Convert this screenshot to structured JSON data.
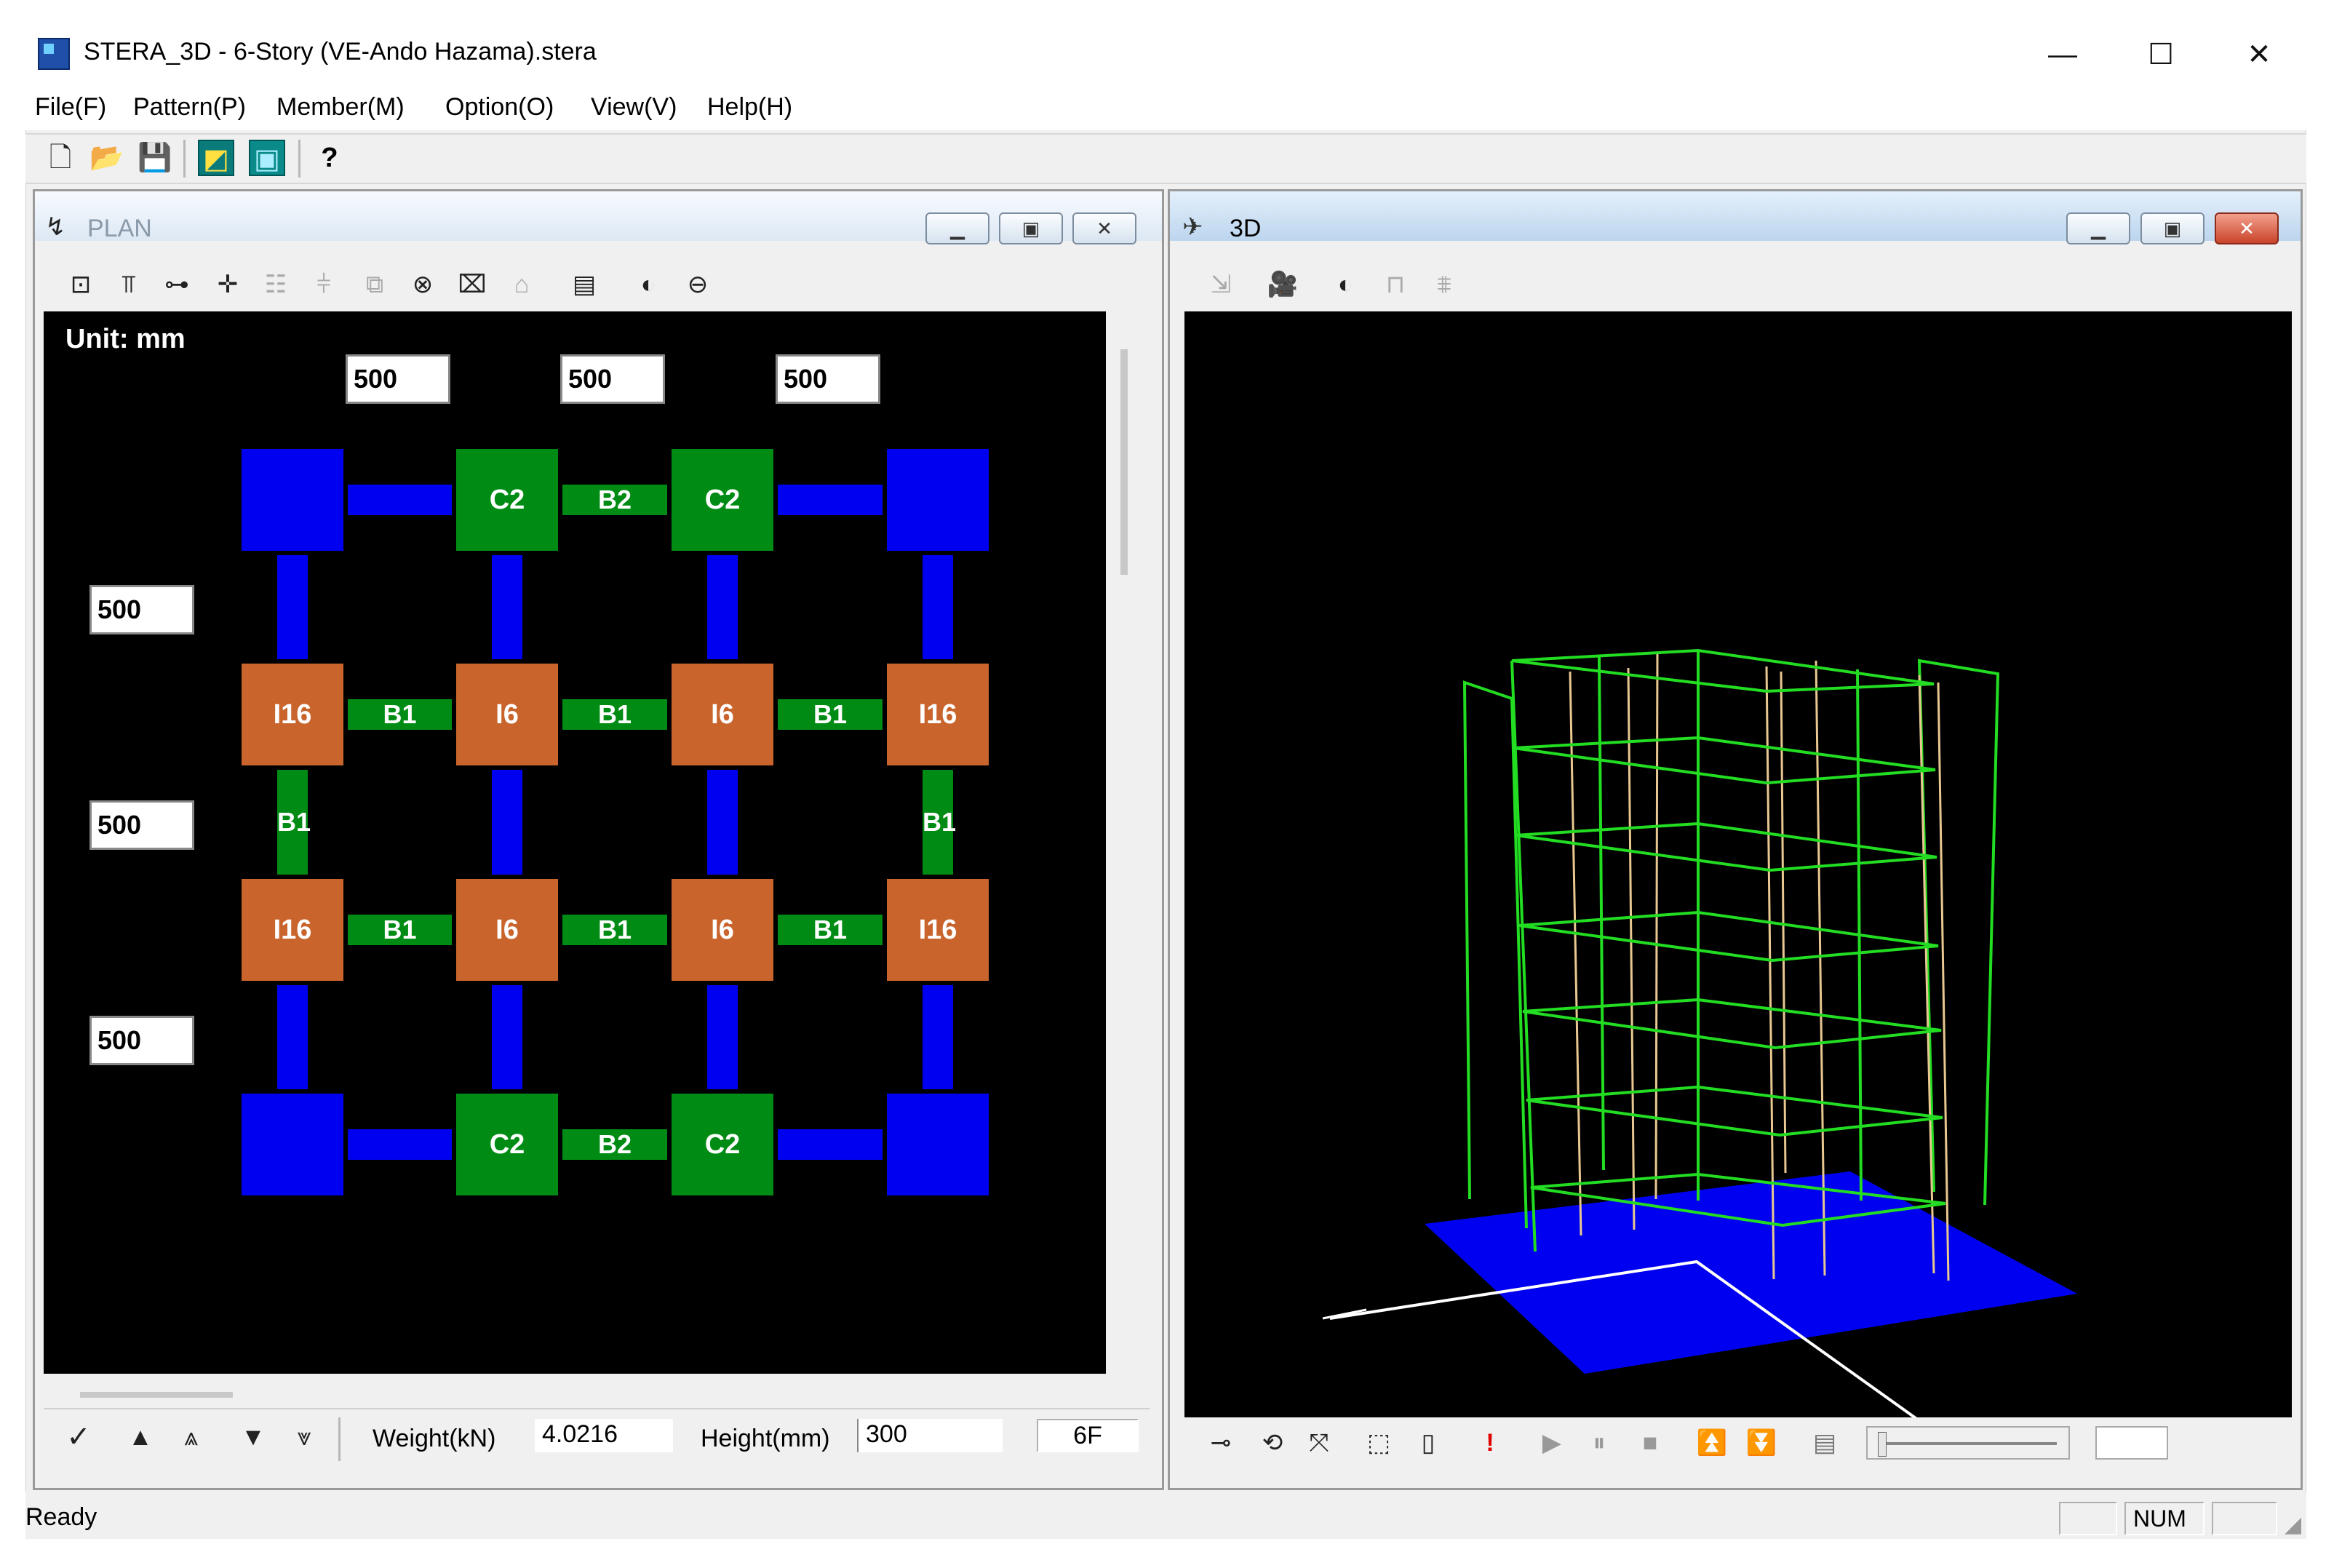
{
  "window": {
    "title": "STERA_3D - 6-Story (VE-Ando Hazama).stera",
    "minimize": "—",
    "maximize": "☐",
    "close": "✕"
  },
  "menu": [
    "File(F)",
    "Pattern(P)",
    "Member(M)",
    "Option(O)",
    "View(V)",
    "Help(H)"
  ],
  "toolbar": {
    "icons": [
      "new-file-icon",
      "open-folder-icon",
      "save-icon",
      "plan-view-icon",
      "3d-view-icon",
      "help-icon"
    ]
  },
  "plan": {
    "title": "PLAN",
    "unit_label": "Unit: mm",
    "spans_x": [
      "500",
      "500",
      "500"
    ],
    "spans_y": [
      "500",
      "500",
      "500"
    ],
    "rows": [
      {
        "columns": [
          "",
          "C2",
          "C2",
          ""
        ],
        "column_colors": [
          "blue",
          "green",
          "green",
          "blue"
        ],
        "beams": [
          "",
          "B2",
          ""
        ],
        "beam_colors": [
          "blue",
          "green",
          "blue"
        ]
      },
      {
        "columns": [
          "I16",
          "I6",
          "I6",
          "I16"
        ],
        "column_colors": [
          "orange",
          "orange",
          "orange",
          "orange"
        ],
        "beams": [
          "B1",
          "B1",
          "B1"
        ],
        "beam_colors": [
          "green",
          "green",
          "green"
        ]
      },
      {
        "columns": [
          "I16",
          "I6",
          "I6",
          "I16"
        ],
        "column_colors": [
          "orange",
          "orange",
          "orange",
          "orange"
        ],
        "beams": [
          "B1",
          "B1",
          "B1"
        ],
        "beam_colors": [
          "green",
          "green",
          "green"
        ]
      },
      {
        "columns": [
          "",
          "C2",
          "C2",
          ""
        ],
        "column_colors": [
          "blue",
          "green",
          "green",
          "blue"
        ],
        "beams": [
          "",
          "B2",
          ""
        ],
        "beam_colors": [
          "blue",
          "green",
          "blue"
        ]
      }
    ],
    "vbeams": [
      {
        "labels": [
          "",
          "",
          "",
          ""
        ],
        "colors": [
          "blue",
          "blue",
          "blue",
          "blue"
        ]
      },
      {
        "labels": [
          "B1",
          "",
          "",
          "B1"
        ],
        "colors": [
          "green",
          "blue",
          "blue",
          "green"
        ]
      },
      {
        "labels": [
          "",
          "",
          "",
          ""
        ],
        "colors": [
          "blue",
          "blue",
          "blue",
          "blue"
        ]
      }
    ],
    "weight_label": "Weight(kN)",
    "weight_value": "4.0216",
    "height_label": "Height(mm)",
    "height_value": "300",
    "floor": "6F"
  },
  "view3d": {
    "title": "3D"
  },
  "colors": {
    "blue": "#0000f0",
    "green": "#008c14",
    "orange": "#c8642c",
    "wire_green": "#22dd22",
    "wire_tan": "#e8c890"
  },
  "status": {
    "ready": "Ready",
    "num": "NUM"
  }
}
